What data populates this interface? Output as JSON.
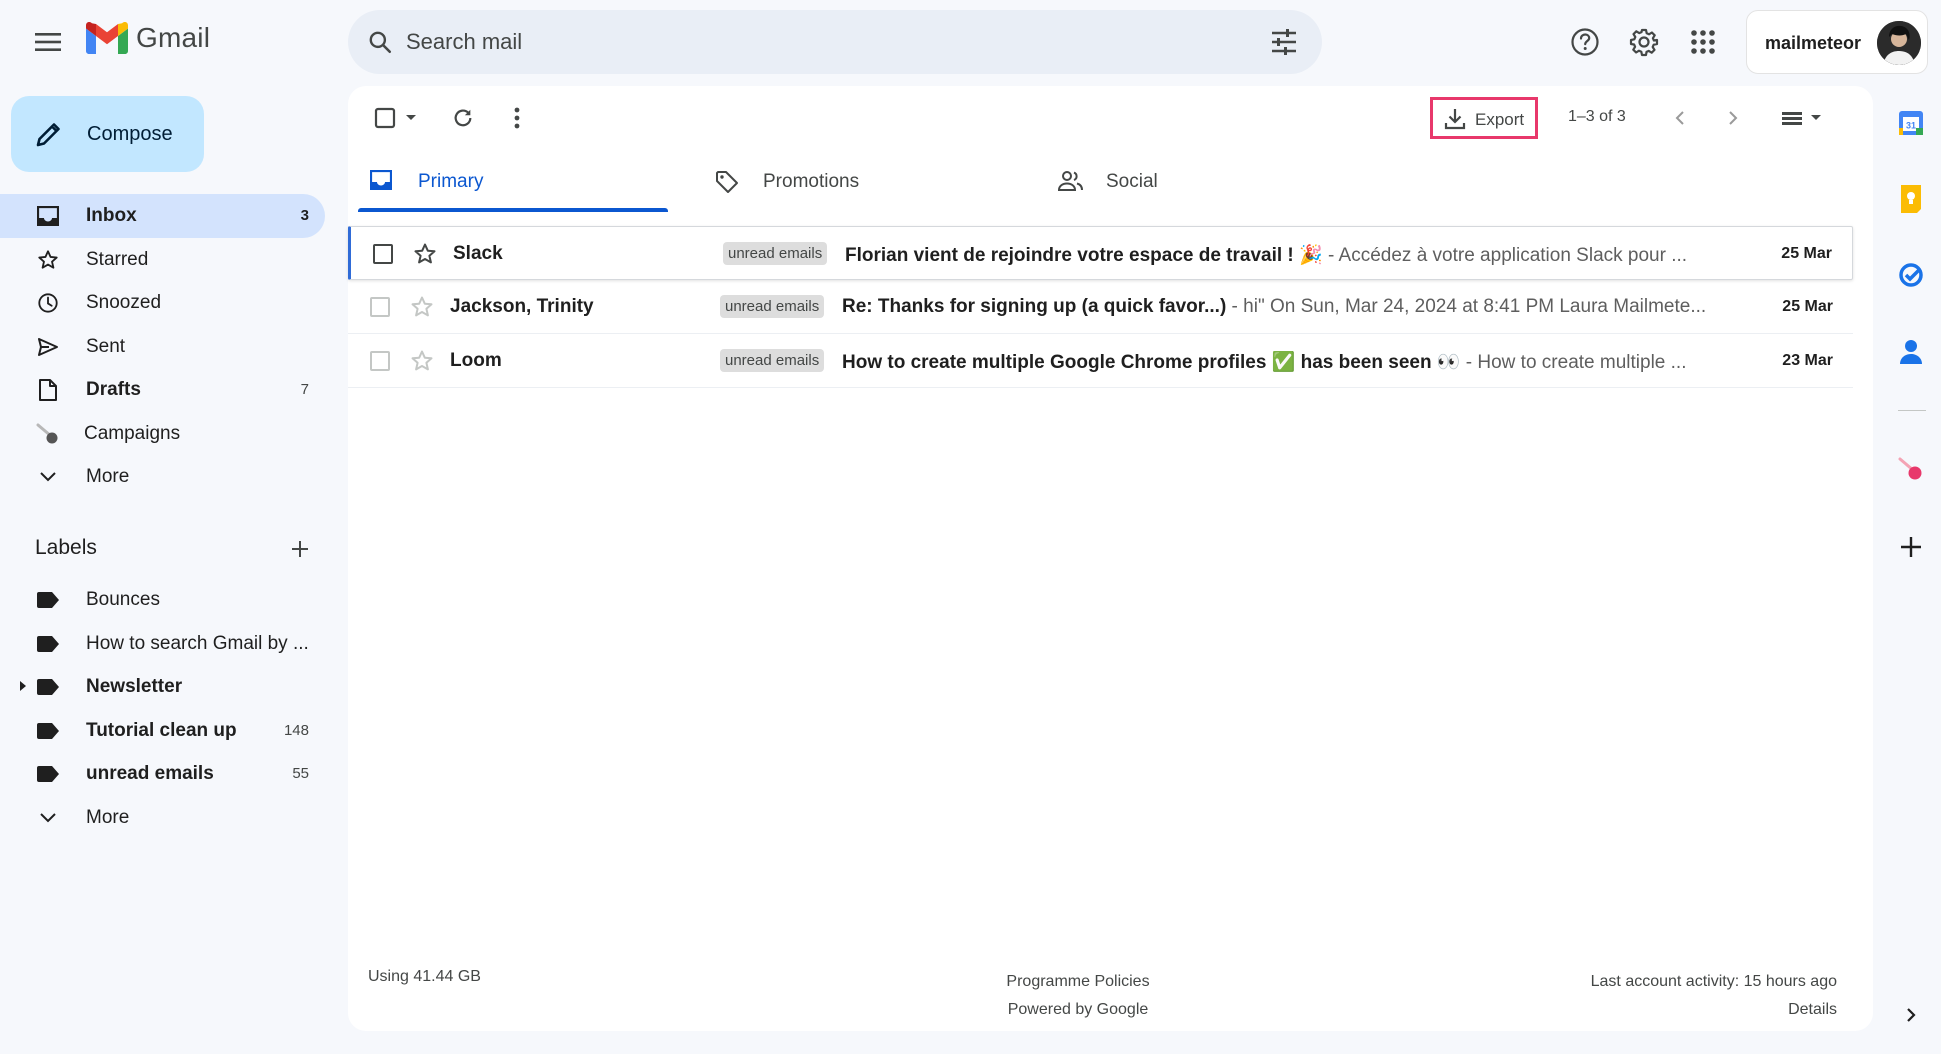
{
  "app": {
    "name": "Gmail"
  },
  "search": {
    "placeholder": "Search mail"
  },
  "account": {
    "name": "mailmeteor"
  },
  "compose": {
    "label": "Compose"
  },
  "nav": [
    {
      "label": "Inbox",
      "count": "3",
      "icon": "inbox-icon",
      "active": true
    },
    {
      "label": "Starred",
      "count": "",
      "icon": "star-icon"
    },
    {
      "label": "Snoozed",
      "count": "",
      "icon": "clock-icon"
    },
    {
      "label": "Sent",
      "count": "",
      "icon": "send-icon"
    },
    {
      "label": "Drafts",
      "count": "7",
      "icon": "draft-icon"
    },
    {
      "label": "Campaigns",
      "count": "",
      "icon": "mailmeteor-icon"
    },
    {
      "label": "More",
      "count": "",
      "icon": "chevron-down-icon"
    }
  ],
  "labels": {
    "title": "Labels",
    "items": [
      {
        "label": "Bounces",
        "count": ""
      },
      {
        "label": "How to search Gmail by ...",
        "count": ""
      },
      {
        "label": "Newsletter",
        "count": ""
      },
      {
        "label": "Tutorial clean up",
        "count": "148"
      },
      {
        "label": "unread emails",
        "count": "55"
      },
      {
        "label": "More",
        "count": ""
      }
    ]
  },
  "toolbar": {
    "export_label": "Export",
    "pagination": "1–3 of 3"
  },
  "tabs": [
    {
      "label": "Primary",
      "icon": "inbox-tab-icon",
      "active": true
    },
    {
      "label": "Promotions",
      "icon": "tag-icon"
    },
    {
      "label": "Social",
      "icon": "people-icon"
    }
  ],
  "emails": [
    {
      "sender": "Slack",
      "tag": "unread emails",
      "subject": "Florian vient de rejoindre votre espace de travail ! 🎉",
      "snippet": " - Accédez à votre application Slack pour ...",
      "date": "25 Mar"
    },
    {
      "sender": "Jackson, Trinity",
      "tag": "unread emails",
      "subject": "Re: Thanks for signing up (a quick favor...)",
      "snippet": " - hi\" On Sun, Mar 24, 2024 at 8:41 PM Laura Mailmete...",
      "date": "25 Mar"
    },
    {
      "sender": "Loom",
      "tag": "unread emails",
      "subject": "How to create multiple Google Chrome profiles ✅ has been seen 👀",
      "snippet": " - How to create multiple ...",
      "date": "23 Mar"
    }
  ],
  "footer": {
    "storage": "Using 41.44 GB",
    "policies": "Programme Policies",
    "powered": "Powered by Google",
    "activity": "Last account activity: 15 hours ago",
    "details": "Details"
  },
  "colors": {
    "accent": "#0b57d0",
    "compose_bg": "#c2e7ff",
    "active_nav_bg": "#d3e3fd",
    "export_highlight": "#e8386b"
  }
}
